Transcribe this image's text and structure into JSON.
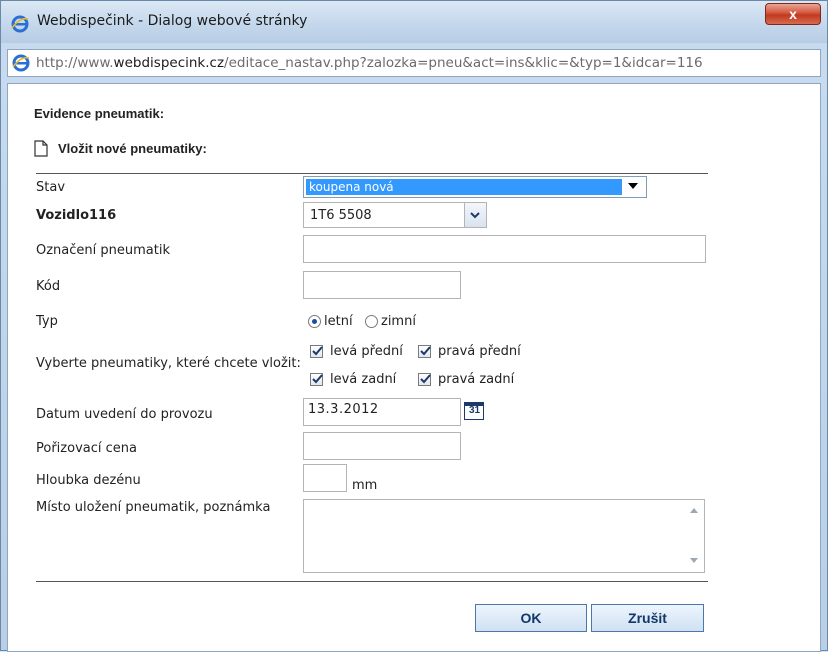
{
  "window": {
    "title": "Webdispečink - Dialog webové stránky",
    "close_label": "x"
  },
  "address": {
    "prefix": "http://www.",
    "domain": "webdispecink.cz",
    "path": "/editace_nastav.php?zalozka=pneu&act=ins&klic=&typ=1&idcar=116"
  },
  "form": {
    "heading": "Evidence pneumatik:",
    "subheading": "Vložit nové pneumatiky:",
    "stav": {
      "label": "Stav",
      "value": "koupena nová"
    },
    "vozidlo": {
      "label": "Vozidlo116",
      "value": "1T6 5508"
    },
    "oznaceni": {
      "label": "Označení pneumatik",
      "value": ""
    },
    "kod": {
      "label": "Kód",
      "value": ""
    },
    "typ": {
      "label": "Typ",
      "options": [
        "letní",
        "zimní"
      ],
      "selected": "letní"
    },
    "pneu_select": {
      "label": "Vyberte pneumatiky, které chcete vložit:",
      "options": [
        "levá přední",
        "pravá přední",
        "levá zadní",
        "pravá zadní"
      ]
    },
    "datum": {
      "label": "Datum uvedení do provozu",
      "value": "13.3.2012",
      "calendar_num": "31"
    },
    "cena": {
      "label": "Pořizovací cena",
      "value": ""
    },
    "hloubka": {
      "label": "Hloubka dezénu",
      "value": "",
      "unit": "mm"
    },
    "misto": {
      "label": "Místo uložení pneumatik, poznámka",
      "value": ""
    }
  },
  "buttons": {
    "ok": "OK",
    "cancel": "Zrušit"
  },
  "colors": {
    "highlight": "#3399ff",
    "button_text": "#13376a"
  }
}
